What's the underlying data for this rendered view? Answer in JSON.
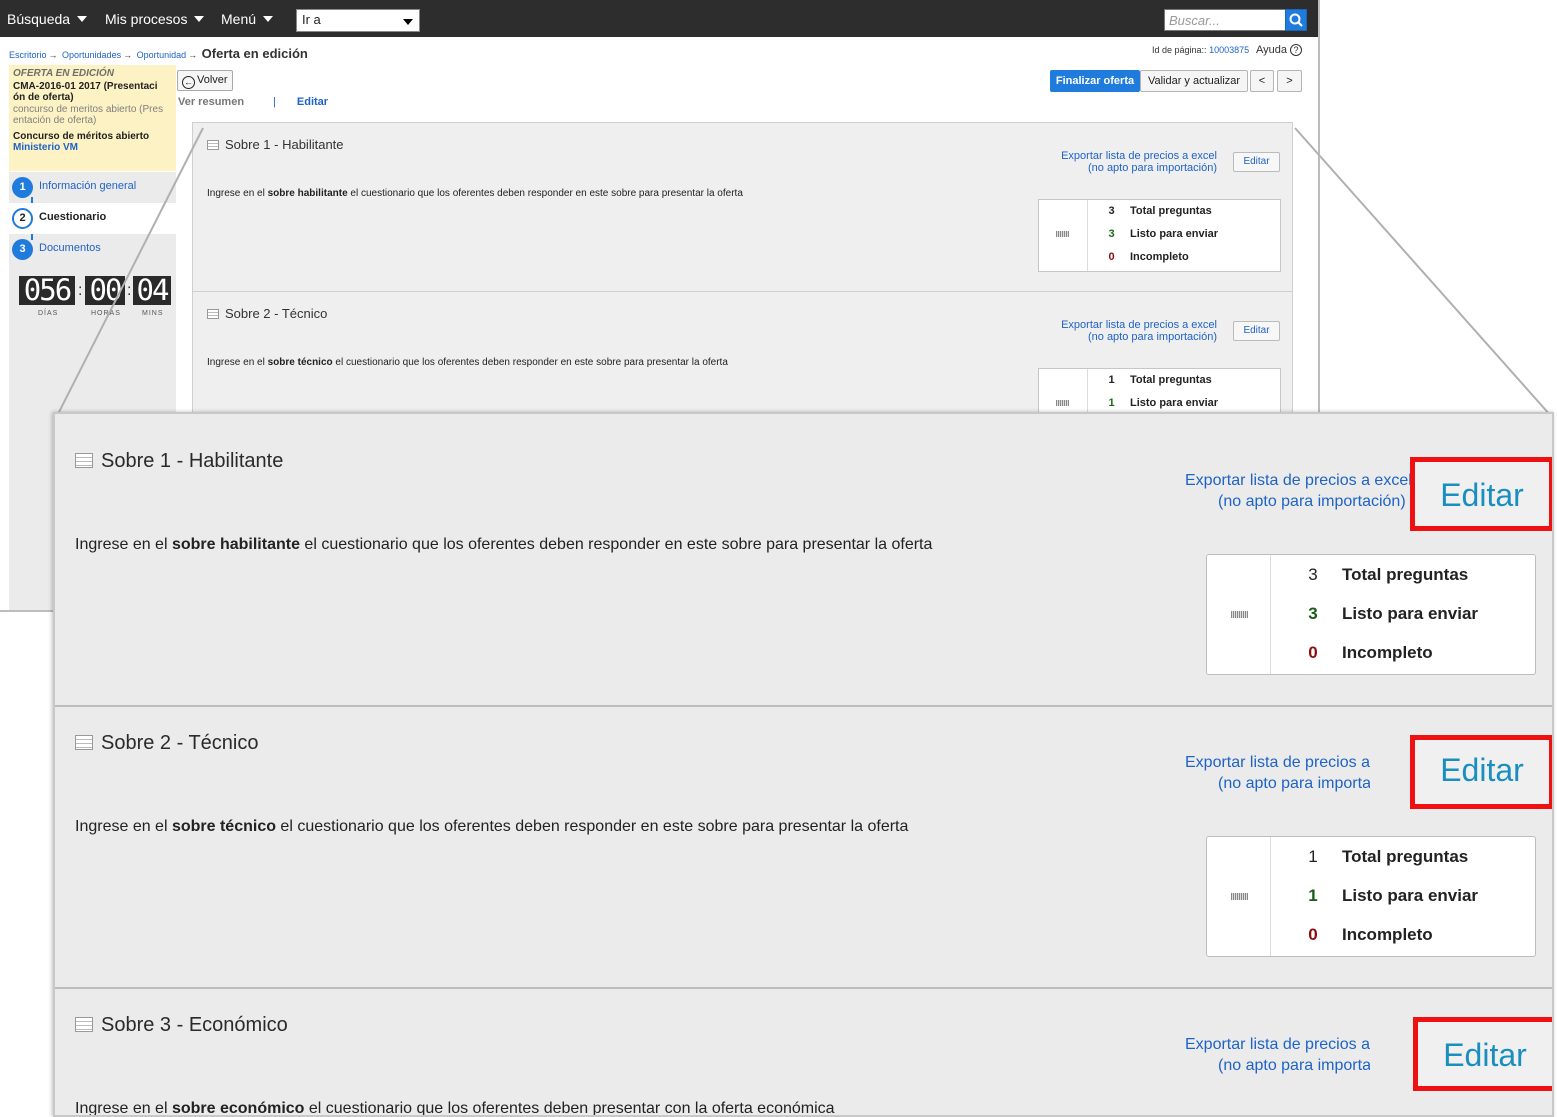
{
  "topbar": {
    "busqueda": "Búsqueda",
    "mis_procesos": "Mis procesos",
    "menu": "Menú",
    "goto_value": "Ir a",
    "search_placeholder": "Buscar..."
  },
  "breadcrumb": {
    "items": [
      "Escritorio",
      "Oportunidades",
      "Oportunidad"
    ],
    "current": "Oferta en edición"
  },
  "page_id": {
    "label": "Id de página::",
    "value": "10003875",
    "help": "Ayuda"
  },
  "offer_info": {
    "status": "OFERTA EN EDICIÓN",
    "name_line1": "CMA-2016-01 2017 (Presentaci",
    "name_line2": "ón de oferta)",
    "desc_line1": "concurso de meritos abierto (Pres",
    "desc_line2": "entación de oferta)",
    "type": "Concurso de méritos abierto",
    "entity": "Ministerio VM"
  },
  "steps": [
    {
      "num": "1",
      "label": "Información general"
    },
    {
      "num": "2",
      "label": "Cuestionario"
    },
    {
      "num": "3",
      "label": "Documentos"
    }
  ],
  "countdown": {
    "days": "056",
    "hours": "00",
    "mins": "04",
    "days_label": "DÍAS",
    "hours_label": "HORAS",
    "mins_label": "MINS"
  },
  "actions": {
    "volver": "Volver",
    "ver_resumen": "Ver resumen",
    "separator": "|",
    "editar": "Editar",
    "finalizar": "Finalizar oferta",
    "validar": "Validar y actualizar",
    "prev": "<",
    "next": ">"
  },
  "envelopes": [
    {
      "title": "Sobre 1 - Habilitante",
      "desc_pre": "Ingrese en el ",
      "desc_bold": "sobre habilitante",
      "desc_post": " el cuestionario que los oferentes deben responder en este sobre para presentar la oferta",
      "export_line1": "Exportar lista de precios a excel",
      "export_line2": "(no apto para importación)",
      "edit": "Editar",
      "total": "3",
      "total_label": "Total preguntas",
      "ready": "3",
      "ready_label": "Listo para enviar",
      "incomplete": "0",
      "incomplete_label": "Incompleto"
    },
    {
      "title": "Sobre 2 - Técnico",
      "desc_pre": "Ingrese en el ",
      "desc_bold": "sobre técnico",
      "desc_post": " el cuestionario que los oferentes deben responder en este sobre para presentar la oferta",
      "export_line1": "Exportar lista de precios a excel",
      "export_line2": "(no apto para importación)",
      "edit": "Editar",
      "total": "1",
      "total_label": "Total preguntas",
      "ready": "1",
      "ready_label": "Listo para enviar",
      "incomplete": "0",
      "incomplete_label": "Incompleto"
    },
    {
      "title": "Sobre 3 - Económico",
      "desc_pre": "Ingrese en el ",
      "desc_bold": "sobre económico",
      "desc_post": " el cuestionario que los oferentes deben presentar con la oferta económica",
      "export_line1": "Exportar lista de precios a",
      "export_line2": "(no apto para importa",
      "edit": "Editar"
    }
  ],
  "colors": {
    "topbar": "#2d2d2d",
    "accent_blue": "#1f7bdc",
    "link": "#1e63c6",
    "highlight_border": "#ee1111",
    "info_bg": "#fdf2c3"
  }
}
